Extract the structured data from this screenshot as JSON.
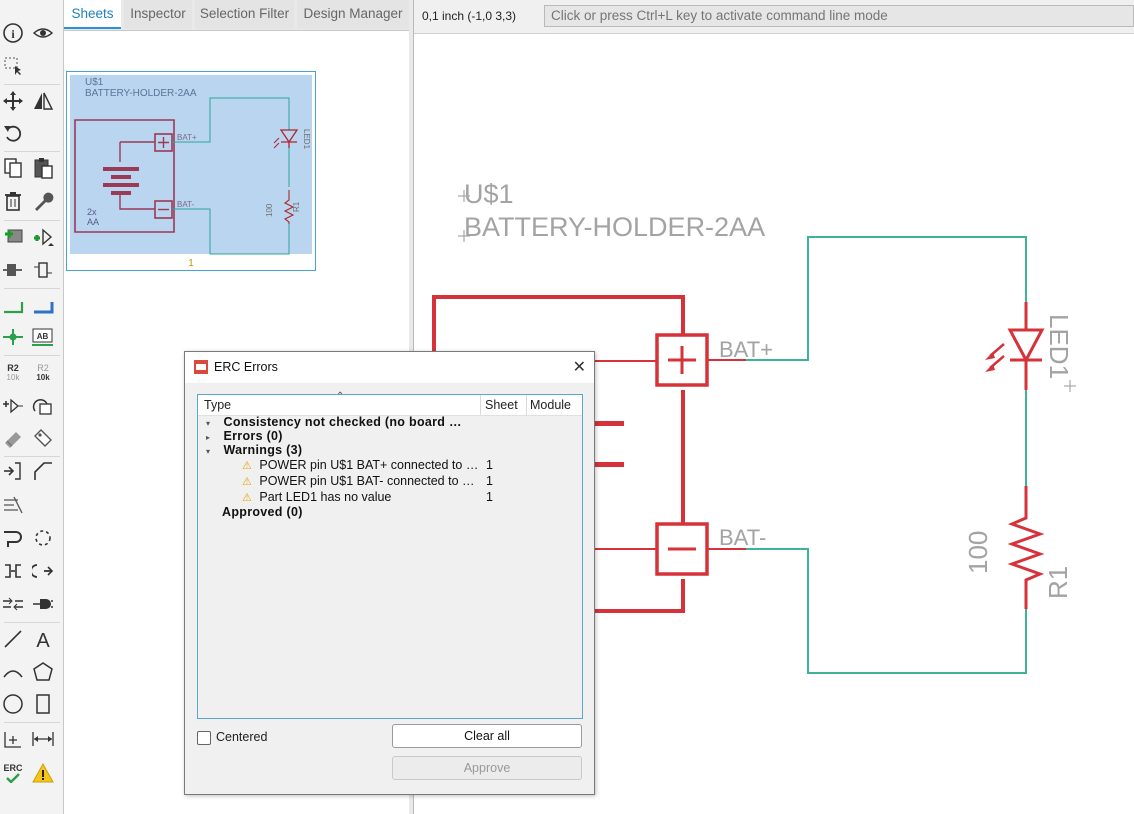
{
  "tabs": [
    "Sheets",
    "Inspector",
    "Selection Filter",
    "Design Manager"
  ],
  "coordinates": "0,1 inch (-1,0 3,3)",
  "command_line": {
    "placeholder": "Click or press Ctrl+L key to activate command line mode"
  },
  "toolbar": {
    "icons": [
      "info-icon",
      "eye-icon",
      "group-select-icon",
      "move-icon",
      "mirror-icon",
      "rotate-icon",
      "copy-icon",
      "paste-icon",
      "delete-icon",
      "wrench-icon",
      "add-part-icon",
      "add-pin-icon",
      "replace-icon",
      "gate-swap-icon",
      "net-icon",
      "bus-icon",
      "junction-icon",
      "label-icon",
      "name-icon",
      "value-icon",
      "pin-swap-icon",
      "gate-icon",
      "smash-icon",
      "attribute-icon",
      "split-icon",
      "miter-icon",
      "invoke-icon",
      "move-net-icon",
      "reconnect-icon",
      "repin-icon",
      "net-break-icon",
      "connect-icon",
      "line-icon",
      "text-icon",
      "arc-icon",
      "polygon-icon",
      "circle-icon",
      "rectangle-icon",
      "origin-icon",
      "dimension-icon",
      "erc-icon",
      "warning-icon"
    ],
    "name_label": "R2",
    "name_sub": "10k",
    "value_label": "R2",
    "value_sub": "10k",
    "text_label": "AB",
    "erc_label": "ERC"
  },
  "sheet_thumbnail": {
    "part_name": "U$1",
    "part_value": "BATTERY-HOLDER-2AA",
    "battery_label_1": "2x",
    "battery_label_2": "AA",
    "pin_plus": "BAT+",
    "pin_minus": "BAT-",
    "led_name": "LED1",
    "resistor_value": "100",
    "resistor_name": "R1",
    "page_number": "1"
  },
  "schematic": {
    "part_name": "U$1",
    "part_value": "BATTERY-HOLDER-2AA",
    "pin_plus": "BAT+",
    "pin_minus": "BAT-",
    "led_name": "LED1",
    "resistor_value": "100",
    "resistor_name": "R1"
  },
  "colors": {
    "symbol": "#d6323a",
    "wire": "#3fb39a",
    "label": "#9a9a9a",
    "thumb_bg": "#b9d5ef",
    "accent": "#2b90d9"
  },
  "erc_dialog": {
    "title": "ERC Errors",
    "columns": [
      "Type",
      "Sheet",
      "Module"
    ],
    "rows": {
      "consistency": "Consistency not checked (no board …",
      "errors": "Errors (0)",
      "warnings": "Warnings (3)",
      "warning_items": [
        {
          "text": "POWER pin U$1 BAT+ connected to …",
          "sheet": "1"
        },
        {
          "text": "POWER pin U$1 BAT- connected to …",
          "sheet": "1"
        },
        {
          "text": "Part LED1 has no value",
          "sheet": "1"
        }
      ],
      "approved": "Approved (0)"
    },
    "centered_label": "Centered",
    "clear_all_label": "Clear all",
    "approve_label": "Approve"
  }
}
